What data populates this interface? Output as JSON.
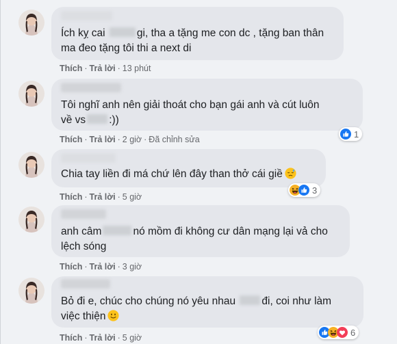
{
  "colors": {
    "background": "#f0f2f5",
    "bubble": "#e4e6eb",
    "like": "#1877f2",
    "haha": "#f7b125"
  },
  "comments": [
    {
      "line1_a": "Ích kỵ cai",
      "line1_b": "gi, tha a tặng me con dc , tặng ban thân",
      "line2": "ma đeo tặng tôi thi a next di",
      "like": "Thích",
      "reply": "Trả lời",
      "time": "13 phút"
    },
    {
      "line1": "Tôi nghĩ anh nên giải thoát cho bạn gái anh và cút luôn",
      "line2_a": "về vs",
      "line2_b": ":))",
      "like": "Thích",
      "reply": "Trả lời",
      "time": "2 giờ",
      "edited": "Đã chỉnh sửa",
      "reaction_icons": [
        "like-icon"
      ],
      "reaction_count": "1"
    },
    {
      "line1": "Chia tay liền đi má chứ lên đây than thở cái giề",
      "emoji": "downcast-sweat-emoji",
      "like": "Thích",
      "reply": "Trả lời",
      "time": "5 giờ",
      "reaction_icons": [
        "haha-icon",
        "like-icon"
      ],
      "reaction_count": "3"
    },
    {
      "line1_a": "anh câm",
      "line1_b": "nó mồm đi không cư dân mạng lại vả cho",
      "line2": "lệch sóng",
      "like": "Thích",
      "reply": "Trả lời",
      "time": "3 giờ"
    },
    {
      "line1_a": "Bỏ đi e, chúc cho chúng nó yêu nhau",
      "line1_b": "đi, coi như làm",
      "line2": "việc thiện",
      "emoji": "smile-emoji",
      "like": "Thích",
      "reply": "Trả lời",
      "time": "5 giờ",
      "reaction_icons": [
        "like-icon",
        "haha-icon",
        "love-icon"
      ],
      "reaction_count": "6"
    }
  ]
}
